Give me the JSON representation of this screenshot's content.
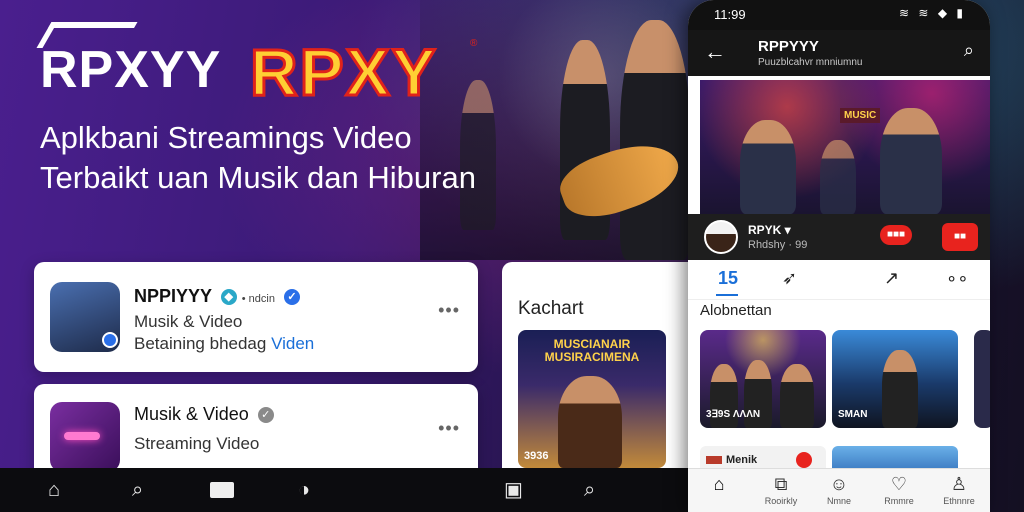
{
  "banner": {
    "logo_white": "RPXYY",
    "logo_gold": "RPXY",
    "registered_mark": "®",
    "headline_line1": "Aplkbani Streamings Video",
    "headline_line2": "Terbaikt uan Musik dan Hiburan"
  },
  "card_primary": {
    "title": "NPPIYYY",
    "meta": "• ndcin",
    "subtitle": "Musik & Video",
    "tag_prefix": "Betaining bhedag",
    "tag_link": "Viden",
    "more": "•••"
  },
  "card_secondary": {
    "title": "Musik & Video",
    "subtitle": "Streaming Video",
    "more": "•••"
  },
  "card_chart": {
    "heading": "Kachart",
    "poster_title": "MUSCIANAIR MUSIRACIMENA",
    "poster_number": "3936"
  },
  "bottom_bar": {
    "icons": [
      "home-icon",
      "search-icon",
      "tv-icon",
      "compass-icon",
      "play-icon",
      "search-icon"
    ]
  },
  "phone": {
    "status": {
      "time": "11:99",
      "icons": "≋ ≋ ◆ ▮"
    },
    "appbar": {
      "back": "←",
      "title": "RPPYYY",
      "subtitle": "Puuzblcahvr mnniumnu",
      "search": "⌕"
    },
    "video": {
      "banner": "MUSIC"
    },
    "channel": {
      "name": "RPYK ▾",
      "subs": "Rhdshy · 99",
      "btn1": "■■■",
      "btn2": "■■"
    },
    "actions": [
      "15",
      "➶",
      "↗",
      "∘∘"
    ],
    "section_title": "Alobnettan",
    "tiles": [
      {
        "label": "3∃9S ΛΛΛN"
      },
      {
        "label": "SMAN"
      }
    ],
    "row2": {
      "text": "Menik"
    },
    "nav": [
      {
        "icon": "⌂",
        "label": ""
      },
      {
        "icon": "⧉",
        "label": "Rooirkly"
      },
      {
        "icon": "☺",
        "label": "Nmne"
      },
      {
        "icon": "♡",
        "label": "Rmmre"
      },
      {
        "icon": "♙",
        "label": "Ethnnre"
      }
    ]
  },
  "colors": {
    "accent_blue": "#1a6fd8",
    "brand_red": "#e8231e",
    "gold": "#ffcf33"
  }
}
